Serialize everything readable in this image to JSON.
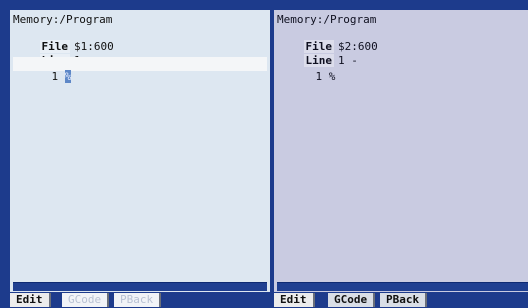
{
  "left_pane": {
    "memory_path": "Memory:/Program",
    "file_label": "File",
    "file_value": "$1:600",
    "line_label": "Line",
    "line_value": "1 -",
    "row_number": "1",
    "row_content": "%"
  },
  "right_pane": {
    "memory_path": "Memory:/Program",
    "file_label": "File",
    "file_value": "$2:600",
    "line_label": "Line",
    "line_value": "1 -",
    "row_number": "1",
    "row_content": "%"
  },
  "tabs_left": [
    "Edit",
    "GCode",
    "PBack"
  ],
  "tabs_right": [
    "Edit",
    "GCode",
    "PBack"
  ]
}
